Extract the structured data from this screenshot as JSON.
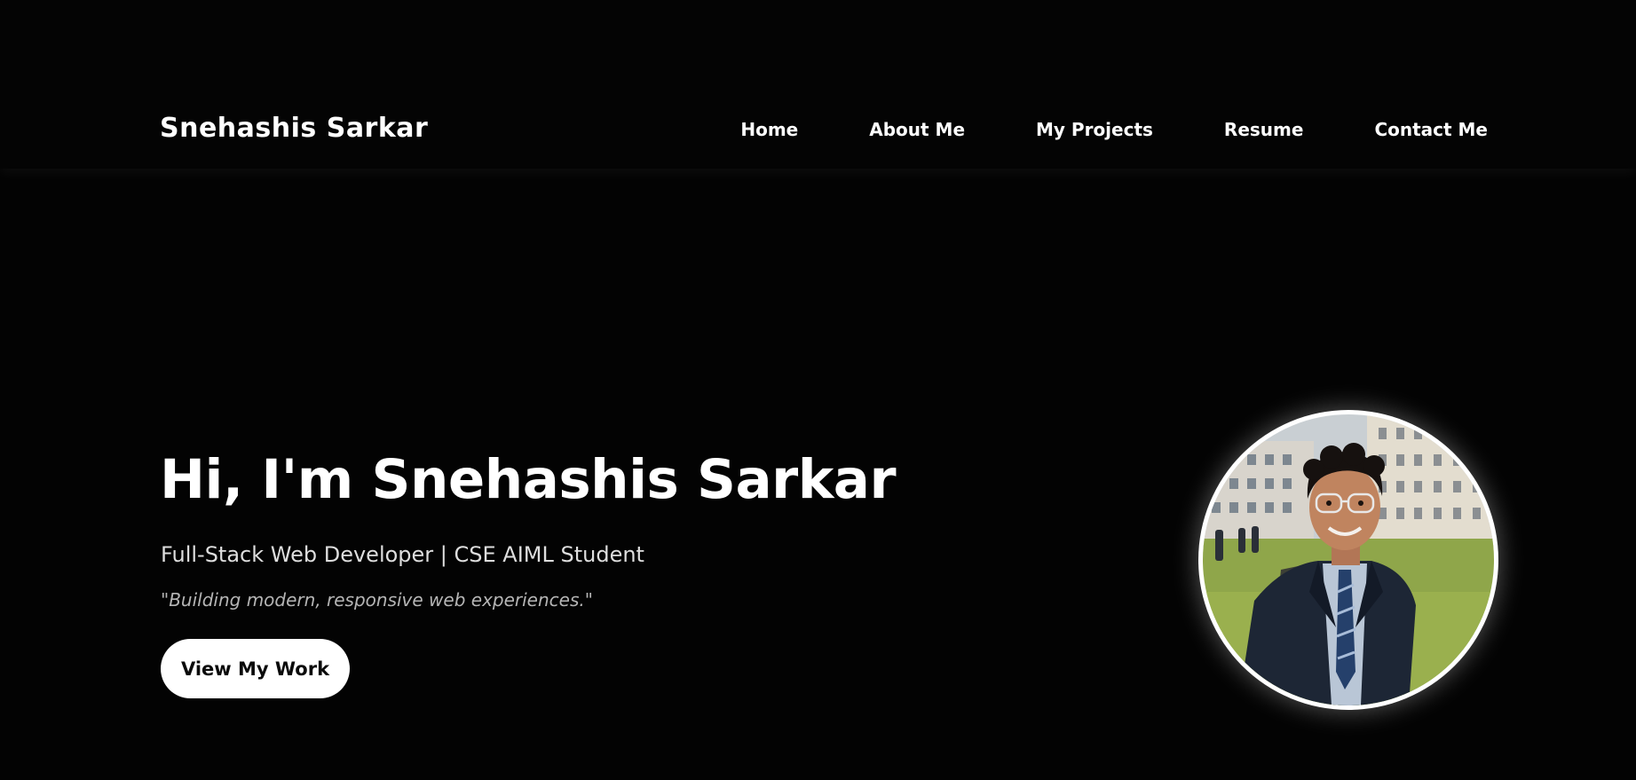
{
  "header": {
    "brand": "Snehashis Sarkar",
    "nav": [
      {
        "label": "Home"
      },
      {
        "label": "About Me"
      },
      {
        "label": "My Projects"
      },
      {
        "label": "Resume"
      },
      {
        "label": "Contact Me"
      }
    ]
  },
  "hero": {
    "title": "Hi, I'm Snehashis Sarkar",
    "subtitle": "Full-Stack Web Developer | CSE AIML Student",
    "tagline": "\"Building modern, responsive web experiences.\"",
    "cta_label": "View My Work",
    "avatar_icon": "profile-photo"
  },
  "colors": {
    "background": "#030303",
    "text": "#ffffff",
    "button_bg": "#ffffff",
    "button_text": "#0a0a0a"
  }
}
